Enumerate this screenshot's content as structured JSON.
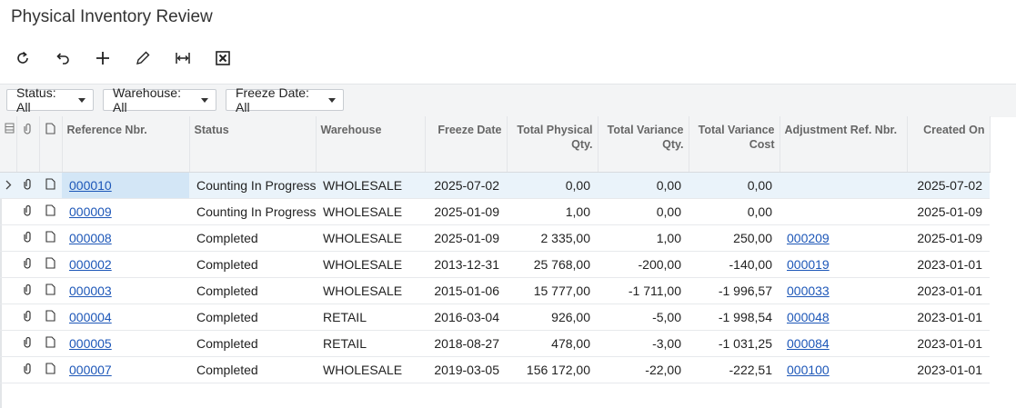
{
  "page": {
    "title": "Physical Inventory Review"
  },
  "toolbar": {
    "buttons": [
      {
        "name": "refresh-button",
        "icon": "refresh-icon"
      },
      {
        "name": "undo-button",
        "icon": "undo-icon"
      },
      {
        "name": "add-button",
        "icon": "plus-icon"
      },
      {
        "name": "edit-button",
        "icon": "pencil-icon"
      },
      {
        "name": "fit-columns-button",
        "icon": "fit-width-icon"
      },
      {
        "name": "export-excel-button",
        "icon": "excel-icon"
      }
    ]
  },
  "filters": {
    "status": "Status: All",
    "warehouse": "Warehouse: All",
    "freeze_date": "Freeze Date: All"
  },
  "grid": {
    "headers": {
      "reference": "Reference Nbr.",
      "status": "Status",
      "warehouse": "Warehouse",
      "freeze_date": "Freeze Date",
      "total_physical": "Total Physical Qty.",
      "total_variance_qty": "Total Variance Qty.",
      "total_variance_cost": "Total Variance Cost",
      "adjustment_ref": "Adjustment Ref. Nbr.",
      "created_on": "Created On"
    },
    "rows": [
      {
        "ref": "000010",
        "status": "Counting In Progress",
        "warehouse": "WHOLESALE",
        "freeze": "2025-07-02",
        "phys": "0,00",
        "vqty": "0,00",
        "vcost": "0,00",
        "adj": "",
        "created": "2025-07-02"
      },
      {
        "ref": "000009",
        "status": "Counting In Progress",
        "warehouse": "WHOLESALE",
        "freeze": "2025-01-09",
        "phys": "1,00",
        "vqty": "0,00",
        "vcost": "0,00",
        "adj": "",
        "created": "2025-01-09"
      },
      {
        "ref": "000008",
        "status": "Completed",
        "warehouse": "WHOLESALE",
        "freeze": "2025-01-09",
        "phys": "2 335,00",
        "vqty": "1,00",
        "vcost": "250,00",
        "adj": "000209",
        "created": "2025-01-09"
      },
      {
        "ref": "000002",
        "status": "Completed",
        "warehouse": "WHOLESALE",
        "freeze": "2013-12-31",
        "phys": "25 768,00",
        "vqty": "-200,00",
        "vcost": "-140,00",
        "adj": "000019",
        "created": "2023-01-01"
      },
      {
        "ref": "000003",
        "status": "Completed",
        "warehouse": "WHOLESALE",
        "freeze": "2015-01-06",
        "phys": "15 777,00",
        "vqty": "-1 711,00",
        "vcost": "-1 996,57",
        "adj": "000033",
        "created": "2023-01-01"
      },
      {
        "ref": "000004",
        "status": "Completed",
        "warehouse": "RETAIL",
        "freeze": "2016-03-04",
        "phys": "926,00",
        "vqty": "-5,00",
        "vcost": "-1 998,54",
        "adj": "000048",
        "created": "2023-01-01"
      },
      {
        "ref": "000005",
        "status": "Completed",
        "warehouse": "RETAIL",
        "freeze": "2018-08-27",
        "phys": "478,00",
        "vqty": "-3,00",
        "vcost": "-1 031,25",
        "adj": "000084",
        "created": "2023-01-01"
      },
      {
        "ref": "000007",
        "status": "Completed",
        "warehouse": "WHOLESALE",
        "freeze": "2019-03-05",
        "phys": "156 172,00",
        "vqty": "-22,00",
        "vcost": "-222,51",
        "adj": "000100",
        "created": "2023-01-01"
      }
    ],
    "selected_row": 0
  },
  "colors": {
    "link": "#1d57b8",
    "selected_row": "#eaf3fa",
    "header_bg": "#f3f4f5"
  }
}
